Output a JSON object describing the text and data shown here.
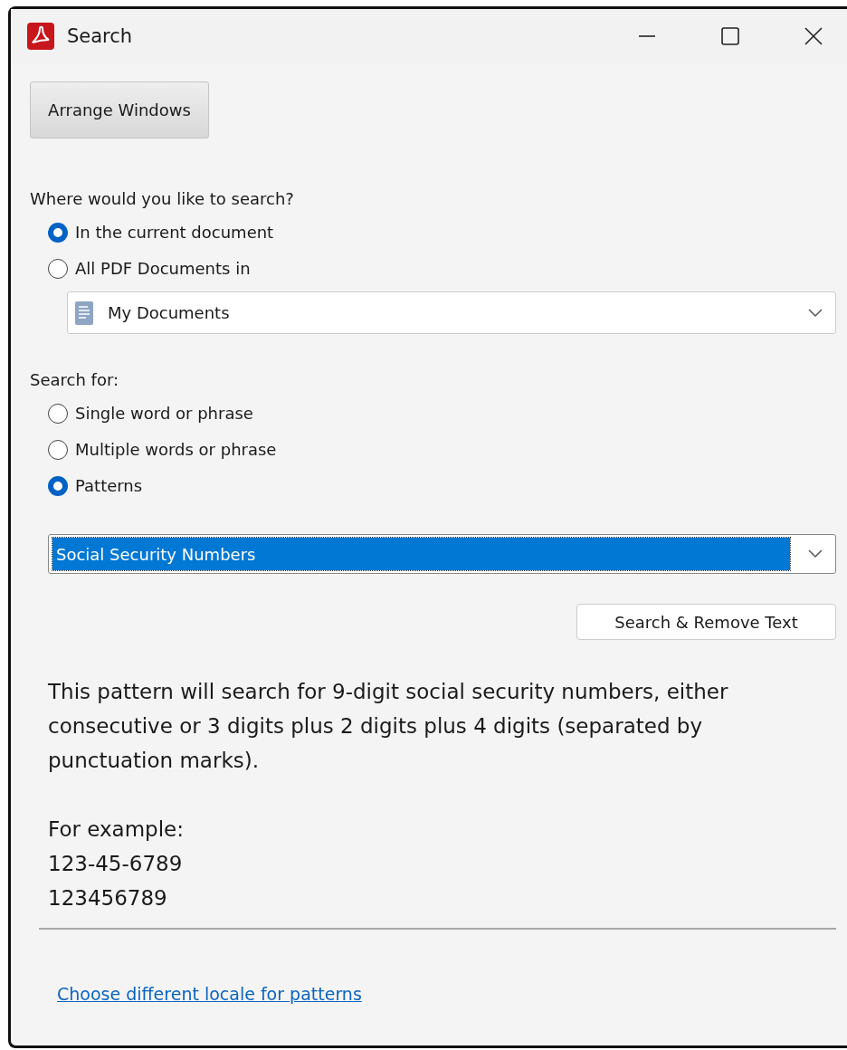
{
  "window": {
    "title": "Search"
  },
  "arrange_button": "Arrange Windows",
  "location": {
    "label": "Where would you like to search?",
    "options": [
      {
        "label": "In the current document",
        "selected": true
      },
      {
        "label": "All PDF Documents in",
        "selected": false
      }
    ],
    "folder_dropdown": "My Documents"
  },
  "search_for": {
    "label": "Search for:",
    "options": [
      {
        "label": "Single word or phrase",
        "selected": false
      },
      {
        "label": "Multiple words or phrase",
        "selected": false
      },
      {
        "label": "Patterns",
        "selected": true
      }
    ],
    "pattern_dropdown": "Social Security Numbers"
  },
  "action_button": "Search & Remove Text",
  "description": "This pattern will search for 9-digit social security numbers, either consecutive or 3 digits plus 2 digits plus 4 digits (separated by punctuation marks).",
  "example_label": "For example:",
  "examples": [
    "123-45-6789",
    "123456789"
  ],
  "locale_link": "Choose different locale for patterns"
}
